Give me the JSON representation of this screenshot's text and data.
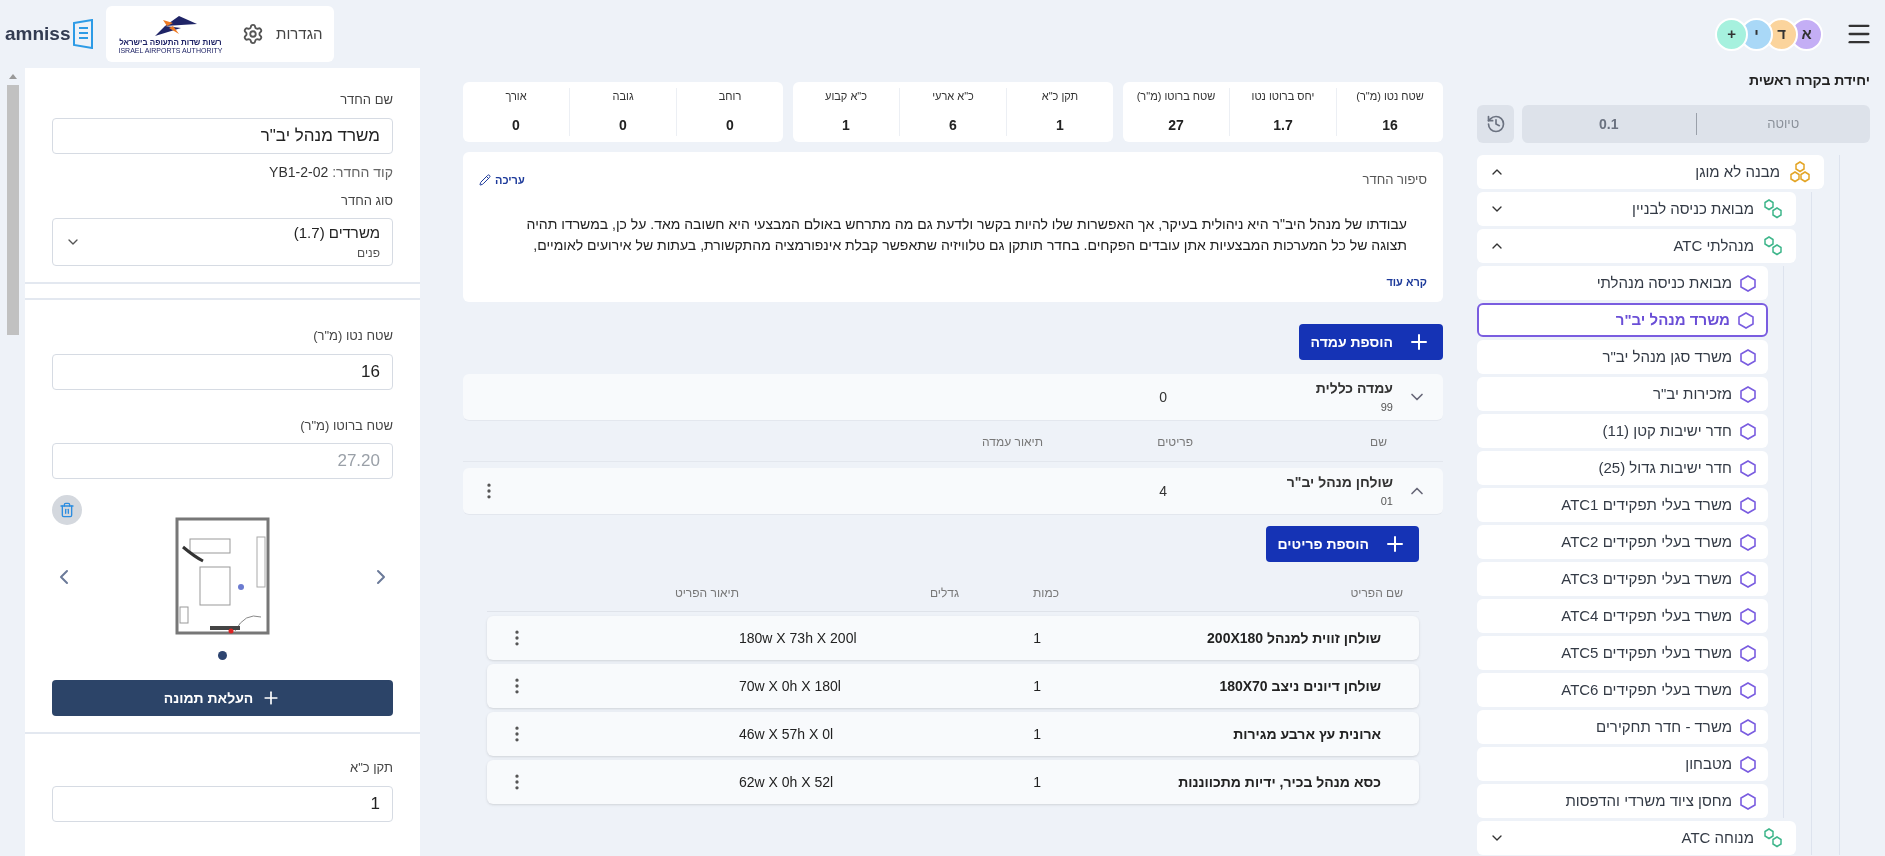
{
  "header": {
    "settings_label": "הגדרות",
    "partner_logo": {
      "hebrew": "רשות שדות התעופה בישראל",
      "english": "ISRAEL AIRPORTS AUTHORITY"
    },
    "brand": "amniss",
    "avatars": [
      {
        "label": "א",
        "color": "#c4aef5"
      },
      {
        "label": "ד",
        "color": "#fbd49c"
      },
      {
        "label": "י",
        "color": "#a9d8f7"
      },
      {
        "label": "+",
        "color": "#a6f1de"
      }
    ]
  },
  "sidebar": {
    "title": "יחידת בקרה ראשית",
    "version": {
      "label": "טיוטה",
      "value": "0.1"
    },
    "tree": [
      {
        "label": "מבנה לא מוגן",
        "kind": "building",
        "expanded": true,
        "selected": false,
        "children": [
          {
            "label": "מבואת כניסה לבניין",
            "kind": "zone",
            "expanded": false,
            "selected": false
          },
          {
            "label": "מנהלתי ATC",
            "kind": "zone",
            "expanded": true,
            "selected": false,
            "children": [
              {
                "label": "מבואת כניסה מנהלתי",
                "kind": "room",
                "selected": false
              },
              {
                "label": "משרד מנהל יב\"ר",
                "kind": "room",
                "selected": true
              },
              {
                "label": "משרד סגן מנהל יב\"ר",
                "kind": "room",
                "selected": false
              },
              {
                "label": "מזכירות יב\"ר",
                "kind": "room",
                "selected": false
              },
              {
                "label": "חדר ישיבות קטן (11)",
                "kind": "room",
                "selected": false
              },
              {
                "label": "חדר ישיבות גדול (25)",
                "kind": "room",
                "selected": false
              },
              {
                "label": "משרד בעלי תפקידים ATC1",
                "kind": "room",
                "selected": false
              },
              {
                "label": "משרד בעלי תפקידים ATC2",
                "kind": "room",
                "selected": false
              },
              {
                "label": "משרד בעלי תפקידים ATC3",
                "kind": "room",
                "selected": false
              },
              {
                "label": "משרד בעלי תפקידים ATC4",
                "kind": "room",
                "selected": false
              },
              {
                "label": "משרד בעלי תפקידים ATC5",
                "kind": "room",
                "selected": false
              },
              {
                "label": "משרד בעלי תפקידים ATC6",
                "kind": "room",
                "selected": false
              },
              {
                "label": "משרד - חדר תחקירים",
                "kind": "room",
                "selected": false
              },
              {
                "label": "מטבחון",
                "kind": "room",
                "selected": false
              },
              {
                "label": "מחסן ציוד משרדי והדפסות",
                "kind": "room",
                "selected": false
              }
            ]
          },
          {
            "label": "מנוחה ATC",
            "kind": "zone",
            "expanded": false,
            "selected": false
          }
        ]
      }
    ]
  },
  "stats": [
    [
      {
        "label": "שטח נטו (מ\"ר)",
        "value": "16"
      },
      {
        "label": "יחס ברוטו נטו",
        "value": "1.7"
      },
      {
        "label": "שטח ברוטו (מ\"ר)",
        "value": "27"
      }
    ],
    [
      {
        "label": "תקן כ\"א",
        "value": "1"
      },
      {
        "label": "כ\"א ארעי",
        "value": "6"
      },
      {
        "label": "כ\"א קבוע",
        "value": "1"
      }
    ],
    [
      {
        "label": "רוחב",
        "value": "0"
      },
      {
        "label": "גובה",
        "value": "0"
      },
      {
        "label": "אורך",
        "value": "0"
      }
    ]
  ],
  "story": {
    "title": "סיפור החדר",
    "edit": "עריכה",
    "text": "עבודתו של מנהל היב\"ר היא ניהולית בעיקר, אך האפשרות שלו להיות בקשר ולדעת גם מה מתרחש באולם המבצעי היא חשובה מאד.  על כן, במשרדו תהיה תצוגה של כל המערכות המבצעיות אתן עובדים הפקחים. בחדר תותקן גם טלוויזיה שתאפשר קבלת אינפורמציה מהתקשורת, בעתות של אירועים לאומיים,",
    "more": "קרא עוד"
  },
  "add_station": "הוספת עמדה",
  "station_columns": [
    "שם",
    "פריטים",
    "תיאור עמדה"
  ],
  "stations": [
    {
      "name": "עמדה כללית",
      "code": "99",
      "items": "0",
      "expanded": false,
      "menu": false
    },
    {
      "name": "שולחן מנהל יב\"ר",
      "code": "01",
      "items": "4",
      "expanded": true,
      "menu": true
    }
  ],
  "add_items": "הוספת פריטים",
  "item_columns": [
    "שם הפריט",
    "כמות",
    "גדלים",
    "תיאור הפריט"
  ],
  "items": [
    {
      "name": "שולחן זווית למנהל 200X180",
      "qty": "1",
      "size": "180w X 73h X 200l"
    },
    {
      "name": "שולחן דיונים ניצב 180X70",
      "qty": "1",
      "size": "70w X 0h X 180l"
    },
    {
      "name": "ארונית עץ ארבע מגירות",
      "qty": "1",
      "size": "46w X 57h X 0l"
    },
    {
      "name": "כסא מנהל בכיר, ידיות מתכווננות",
      "qty": "1",
      "size": "62w X 0h X 52l"
    }
  ],
  "form": {
    "name_label": "שם החדר",
    "name_value": "משרד מנהל יב\"ר",
    "code_label": "קוד החדר:",
    "code_value": "YB1-2-02",
    "type_label": "סוג החדר",
    "type_value": "משרדים (1.7)",
    "type_sub": "פנים",
    "net_label": "שטח נטו (מ\"ר)",
    "net_value": "16",
    "gross_label": "שטח ברוטו (מ\"ר)",
    "gross_value": "27.20",
    "gross_disabled": true,
    "image_dots": [
      {
        "selected": true
      }
    ],
    "upload": "העלאת תמונה",
    "staff_label": "תקן כ\"א",
    "staff_value": "1"
  }
}
